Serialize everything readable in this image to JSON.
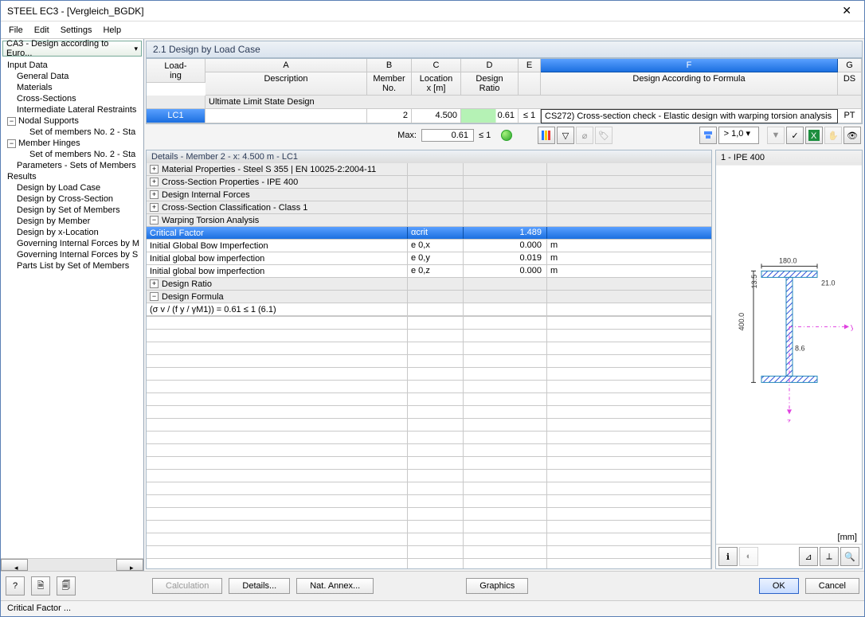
{
  "window": {
    "title": "STEEL EC3 - [Vergleich_BGDK]"
  },
  "menu": {
    "file": "File",
    "edit": "Edit",
    "settings": "Settings",
    "help": "Help"
  },
  "combo": {
    "text": "CA3 - Design according to Euro..."
  },
  "tree": {
    "input": "Input Data",
    "items_input": [
      "General Data",
      "Materials",
      "Cross-Sections",
      "Intermediate Lateral Restraints"
    ],
    "nodal": "Nodal Supports",
    "nodal_sub": "Set of members No. 2 - Sta",
    "hinges": "Member Hinges",
    "hinges_sub": "Set of members No. 2 - Sta",
    "params": "Parameters - Sets of Members",
    "results": "Results",
    "items_results": [
      "Design by Load Case",
      "Design by Cross-Section",
      "Design by Set of Members",
      "Design by Member",
      "Design by x-Location",
      "Governing Internal Forces by M",
      "Governing Internal Forces by S",
      "Parts List by Set of Members"
    ]
  },
  "section": {
    "title": "2.1 Design by Load Case"
  },
  "grid": {
    "corner": "Load-\ning",
    "cols_top": [
      "A",
      "B",
      "C",
      "D",
      "E",
      "F",
      "G"
    ],
    "cols_bot": [
      "Description",
      "Member\nNo.",
      "Location\nx [m]",
      "Design\nRatio",
      "",
      "Design According to Formula",
      "DS"
    ],
    "group": "Ultimate Limit State Design",
    "row": {
      "id": "LC1",
      "desc": "",
      "member": "2",
      "loc": "4.500",
      "ratio": "0.61",
      "cond": "≤ 1",
      "formula": "CS272) Cross-section check - Elastic design with warping torsion analysis",
      "ds": "PT"
    },
    "max_label": "Max:",
    "max_ratio": "0.61",
    "max_cond": "≤ 1"
  },
  "filter": {
    "value": "> 1,0"
  },
  "details": {
    "title": "Details - Member 2 - x: 4.500 m - LC1",
    "r1": "Material Properties - Steel S 355 | EN 10025-2:2004-11",
    "r2": "Cross-Section Properties  -  IPE 400",
    "r3": "Design Internal Forces",
    "r4": "Cross-Section Classification - Class 1",
    "r5": "Warping Torsion Analysis",
    "r5a_l": "Critical Factor",
    "r5a_s": "αcrit",
    "r5a_v": "1.489",
    "r5b_l": "Initial Global Bow Imperfection",
    "r5b_s": "e 0,x",
    "r5b_v": "0.000",
    "r5b_u": "m",
    "r5c_l": "Initial global bow imperfection",
    "r5c_s": "e 0,y",
    "r5c_v": "0.019",
    "r5c_u": "m",
    "r5d_l": "Initial global bow imperfection",
    "r5d_s": "e 0,z",
    "r5d_v": "0.000",
    "r5d_u": "m",
    "r6": "Design Ratio",
    "r7": "Design Formula",
    "r7a": "(σ v / (f y / γM1)) = 0.61 ≤ 1   (6.1)"
  },
  "preview": {
    "title": "1 - IPE 400",
    "unit": "[mm]",
    "d_w": "180.0",
    "d_h": "400.0",
    "d_tf": "13.5",
    "d_tw": "8.6",
    "d_r": "21.0",
    "y": "y",
    "z": "z"
  },
  "buttons": {
    "calc": "Calculation",
    "details": "Details...",
    "annex": "Nat. Annex...",
    "graphics": "Graphics",
    "ok": "OK",
    "cancel": "Cancel"
  },
  "status": "Critical Factor ..."
}
